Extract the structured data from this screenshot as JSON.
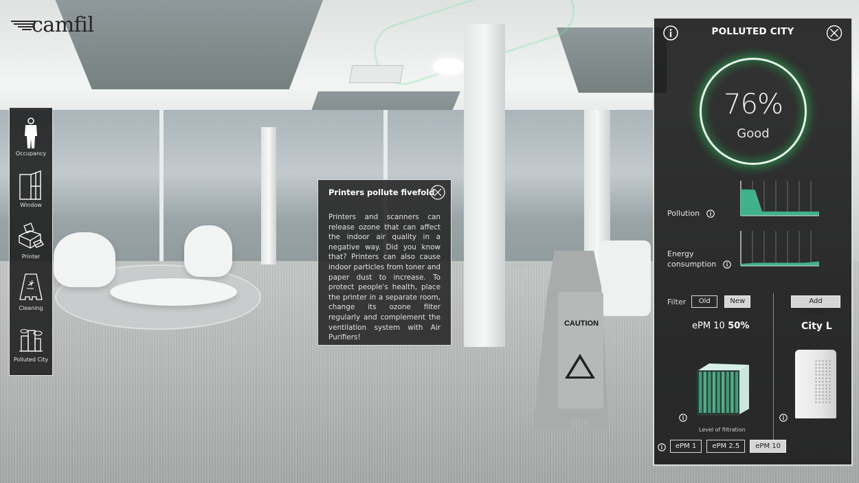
{
  "logo": {
    "text": "camfil"
  },
  "sidebar": {
    "items": [
      {
        "label": "Occupancy",
        "icon": "person-icon"
      },
      {
        "label": "Window",
        "icon": "window-icon"
      },
      {
        "label": "Printer",
        "icon": "printer-icon"
      },
      {
        "label": "Cleaning",
        "icon": "caution-sign-icon"
      },
      {
        "label": "Polluted City",
        "icon": "city-icon"
      }
    ]
  },
  "popup": {
    "title": "Printers pollute fivefold",
    "body": "Printers and scanners can release ozone that can affect the indoor air quality in a negative way. Did you know that? Printers can also cause indoor particles from toner and paper dust to increase. To protect people's health, place the printer in a separate room, change its ozone filter regularly and complement the ventilation system with Air Purifiers!"
  },
  "scene": {
    "caution_sign_text": "CAUTION"
  },
  "panel": {
    "title": "POLLUTED CITY",
    "gauge": {
      "value": "76%",
      "status": "Good",
      "percent": 76,
      "glow_color": "#2ec45a"
    },
    "metrics": [
      {
        "label": "Pollution",
        "series": [
          0.75,
          0.75,
          0.74,
          0.12,
          0.12,
          0.12,
          0.12,
          0.12,
          0.12,
          0.12,
          0.12,
          0.12
        ]
      },
      {
        "label_line1": "Energy",
        "label_line2": "consumption",
        "series": [
          0.06,
          0.07,
          0.09,
          0.09,
          0.09,
          0.09,
          0.09,
          0.09,
          0.09,
          0.09,
          0.11,
          0.13
        ]
      }
    ],
    "chart_fill_color": "#3fb28a",
    "filter": {
      "label": "Filter",
      "options": [
        "Old",
        "New"
      ],
      "selected": "New",
      "spec_name": "ePM 10",
      "spec_value": "50%",
      "level_label": "Level of filtration",
      "levels": [
        "ePM 1",
        "ePM 2.5",
        "ePM 10"
      ],
      "selected_level": "ePM 10"
    },
    "purifier": {
      "add_label": "Add purifier",
      "name": "City L"
    }
  }
}
